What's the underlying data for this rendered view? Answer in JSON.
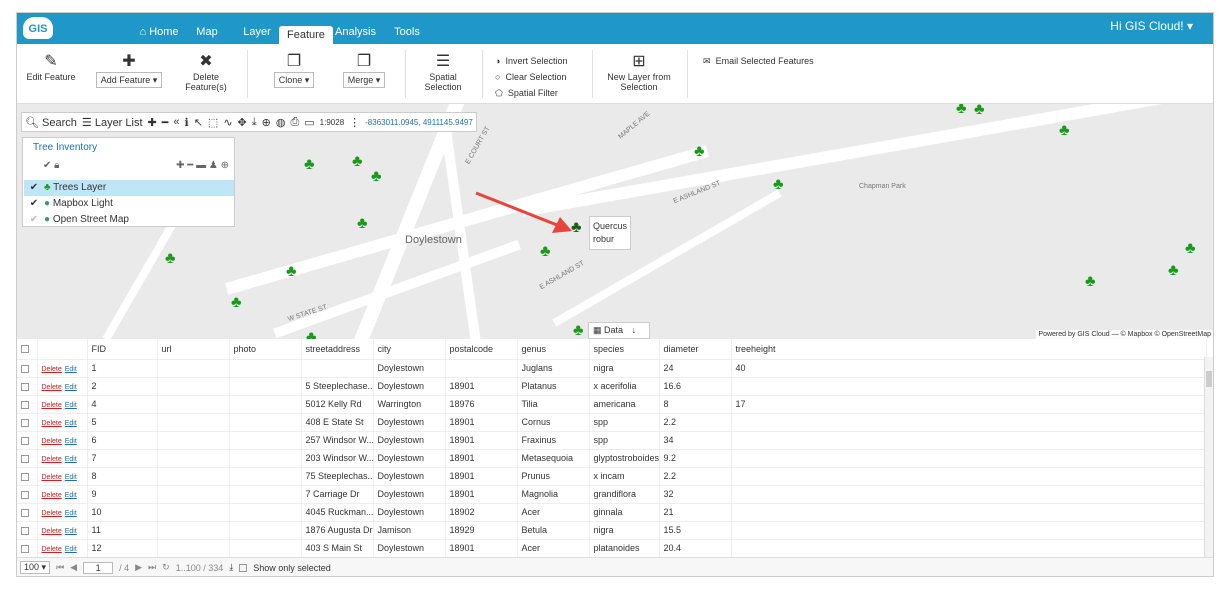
{
  "app": {
    "logo_text": "GIS",
    "user_menu": "Hi GIS Cloud! ▾"
  },
  "nav": {
    "home": "Home",
    "tabs": [
      "Map",
      "Layer",
      "Feature",
      "Analysis",
      "Tools"
    ],
    "active": "Feature"
  },
  "ribbon": {
    "edit_feature": "Edit Feature",
    "add_feature": "Add Feature",
    "delete_feature": "Delete Feature(s)",
    "clone": "Clone",
    "merge": "Merge",
    "spatial_selection": "Spatial Selection",
    "invert_selection": "Invert Selection",
    "clear_selection": "Clear Selection",
    "spatial_filter": "Spatial Filter",
    "new_layer": "New Layer from Selection",
    "email": "Email Selected Features"
  },
  "map_toolbar": {
    "search": "Search",
    "layer_list": "Layer List",
    "scale": "1:9028",
    "coords": "-8363011.0945, 4911145.9497"
  },
  "layer_panel": {
    "title": "Tree Inventory",
    "layers": [
      {
        "name": "Trees Layer",
        "checked": true,
        "selected": true
      },
      {
        "name": "Mapbox Light",
        "checked": true,
        "selected": false
      },
      {
        "name": "Open Street Map",
        "checked": false,
        "selected": false
      }
    ]
  },
  "map_labels": {
    "town": "Doylestown",
    "park": "Chapman Park",
    "st1": "E ASHLAND ST",
    "st2": "E ASHLAND ST",
    "st3": "W STATE ST",
    "st4": "E COURT ST",
    "st5": "MAPLE AVE"
  },
  "tooltip": {
    "line1": "Quercus",
    "line2": "robur"
  },
  "attribution": "Powered by GIS Cloud — © Mapbox © OpenStreetMap",
  "data_tab": "Data",
  "table": {
    "columns": [
      "FID",
      "url",
      "photo",
      "streetaddress",
      "city",
      "postalcode",
      "genus",
      "species",
      "diameter",
      "treeheight"
    ],
    "delete_label": "Delete",
    "edit_label": "Edit",
    "rows": [
      [
        "1",
        "",
        "",
        "",
        "Doylestown",
        "",
        "Juglans",
        "nigra",
        "24",
        "40"
      ],
      [
        "2",
        "",
        "",
        "5 Steeplechase...",
        "Doylestown",
        "18901",
        "Platanus",
        "x acerifolia",
        "16.6",
        ""
      ],
      [
        "4",
        "",
        "",
        "5012 Kelly Rd",
        "Warrington",
        "18976",
        "Tilia",
        "americana",
        "8",
        "17"
      ],
      [
        "5",
        "",
        "",
        "408 E State St",
        "Doylestown",
        "18901",
        "Cornus",
        "spp",
        "2.2",
        ""
      ],
      [
        "6",
        "",
        "",
        "257 Windsor W...",
        "Doylestown",
        "18901",
        "Fraxinus",
        "spp",
        "34",
        ""
      ],
      [
        "7",
        "",
        "",
        "203 Windsor W...",
        "Doylestown",
        "18901",
        "Metasequoia",
        "glyptostroboides",
        "9.2",
        ""
      ],
      [
        "8",
        "",
        "",
        "75 Steeplechas...",
        "Doylestown",
        "18901",
        "Prunus",
        "x incam",
        "2.2",
        ""
      ],
      [
        "9",
        "",
        "",
        "7 Carriage Dr",
        "Doylestown",
        "18901",
        "Magnolia",
        "grandiflora",
        "32",
        ""
      ],
      [
        "10",
        "",
        "",
        "4045 Ruckman...",
        "Doylestown",
        "18902",
        "Acer",
        "ginnala",
        "21",
        ""
      ],
      [
        "11",
        "",
        "",
        "1876 Augusta Dr",
        "Jamison",
        "18929",
        "Betula",
        "nigra",
        "15.5",
        ""
      ],
      [
        "12",
        "",
        "",
        "403 S Main St",
        "Doylestown",
        "18901",
        "Acer",
        "platanoides",
        "20.4",
        ""
      ]
    ]
  },
  "footer": {
    "page_size": "100",
    "page_current": "1",
    "page_total": "/ 4",
    "range": "1..100 / 334",
    "show_selected": "Show only selected"
  },
  "colors": {
    "topbar": "#1f97c9",
    "tree": "#1a9a1a",
    "selected_layer": "#bfe6f7"
  }
}
